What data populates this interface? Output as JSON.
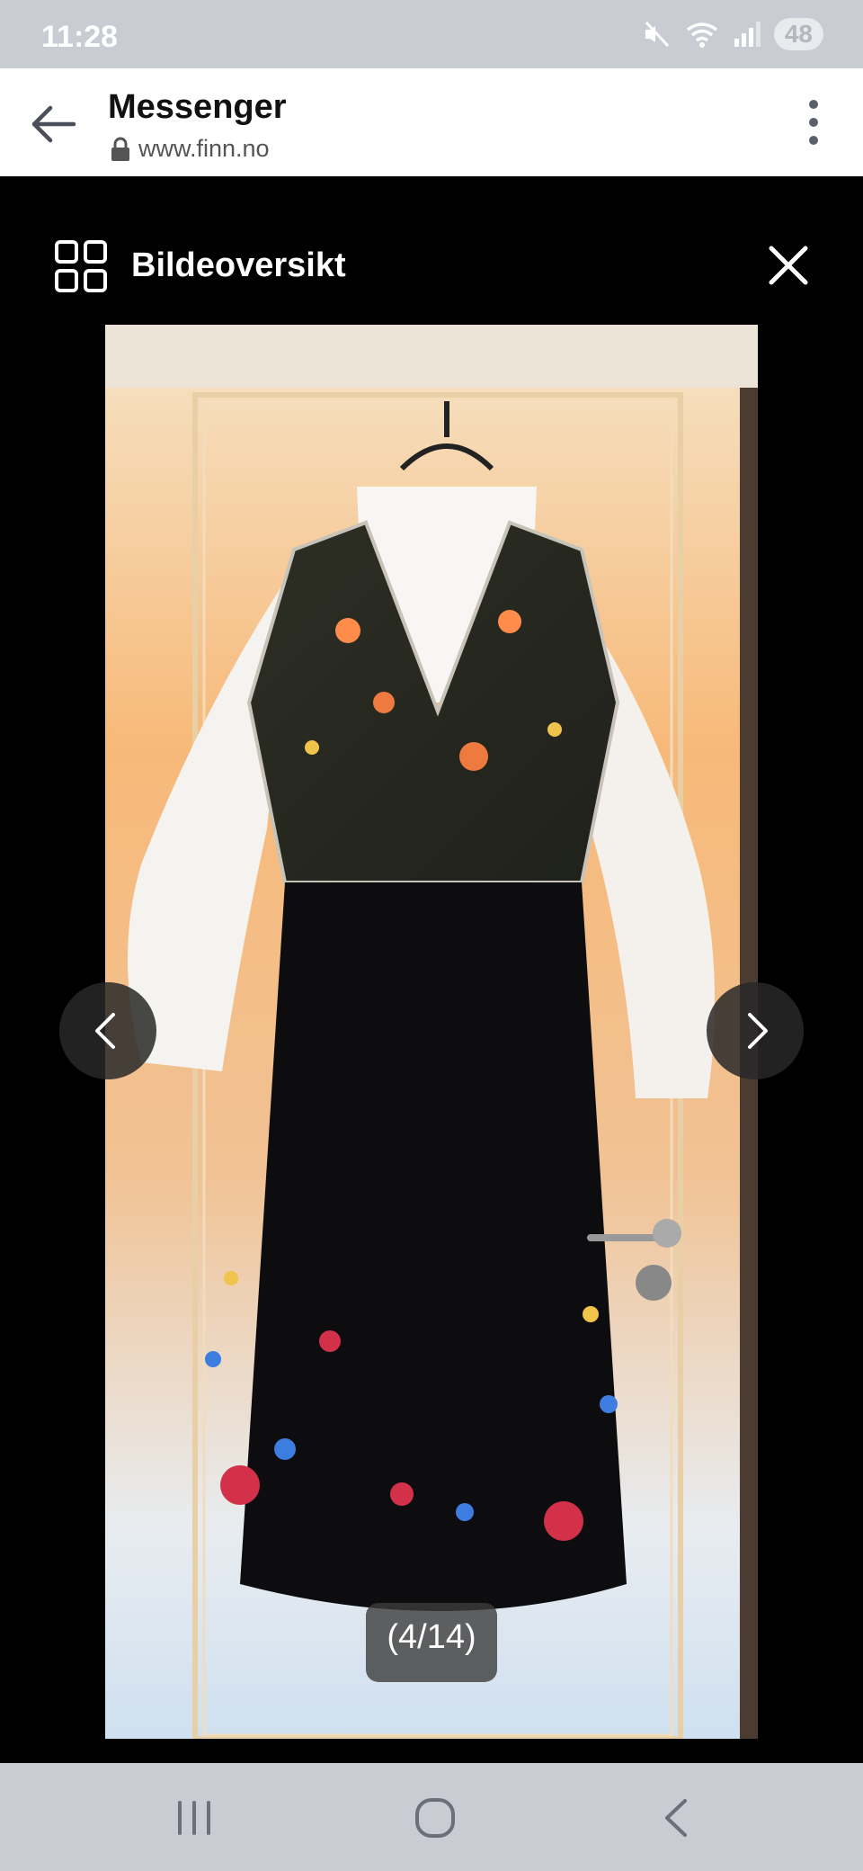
{
  "status_bar": {
    "time": "11:28",
    "battery": "48",
    "icons": [
      "mute-icon",
      "wifi-icon",
      "signal-icon",
      "battery-icon"
    ]
  },
  "browser": {
    "title": "Messenger",
    "url": "www.finn.no",
    "icons": [
      "back-arrow-icon",
      "lock-icon",
      "more-vert-icon"
    ]
  },
  "viewer": {
    "overview_label": "Bildeoversikt",
    "counter": "(4/14)",
    "icons": [
      "grid-icon",
      "close-icon",
      "chevron-left-icon",
      "chevron-right-icon"
    ]
  },
  "nav_bar": {
    "icons": [
      "recents-icon",
      "home-icon",
      "back-icon"
    ]
  },
  "colors": {
    "status_bg": "#c9ccd2",
    "header_bg": "#ffffff",
    "viewer_bg": "#000000"
  }
}
